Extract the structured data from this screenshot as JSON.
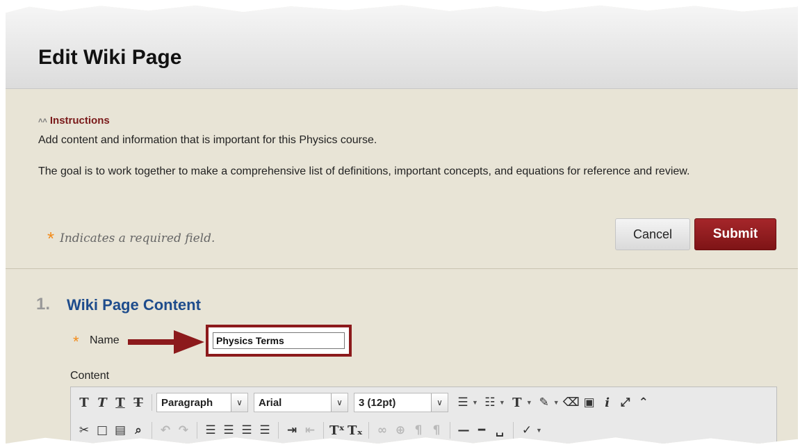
{
  "header": {
    "title": "Edit Wiki Page"
  },
  "instructions": {
    "toggle_label": "Instructions",
    "line1": "Add content and information that is important for this Physics course.",
    "line2": "The goal is to work together to make a comprehensive list of definitions, important concepts, and equations for reference and review."
  },
  "required_note": {
    "star": "*",
    "text": "Indicates a required field."
  },
  "buttons": {
    "cancel": "Cancel",
    "submit": "Submit"
  },
  "section": {
    "number": "1.",
    "title": "Wiki Page Content",
    "name_star": "*",
    "name_label": "Name",
    "name_value": "Physics Terms",
    "content_label": "Content"
  },
  "toolbar": {
    "format_select": "Paragraph",
    "font_select": "Arial",
    "size_select": "3 (12pt)",
    "row1_icons": [
      "bold-icon",
      "italic-icon",
      "underline-icon",
      "strikethrough-icon"
    ],
    "row2_icons": [
      "cut-icon",
      "copy-icon",
      "paste-icon",
      "find-icon",
      "undo-icon",
      "redo-icon",
      "align-left-icon",
      "align-center-icon",
      "align-right-icon",
      "justify-icon",
      "indent-icon",
      "outdent-icon",
      "superscript-icon",
      "subscript-icon",
      "link-icon",
      "unlink-icon",
      "ltr-icon",
      "rtl-icon",
      "horizontal-rule-icon",
      "thick-rule-icon",
      "nonbreaking-space-icon",
      "spellcheck-icon"
    ]
  },
  "colors": {
    "accent_red": "#8c1a1c",
    "required_orange": "#f28b1a",
    "section_blue": "#1e4c8c"
  }
}
